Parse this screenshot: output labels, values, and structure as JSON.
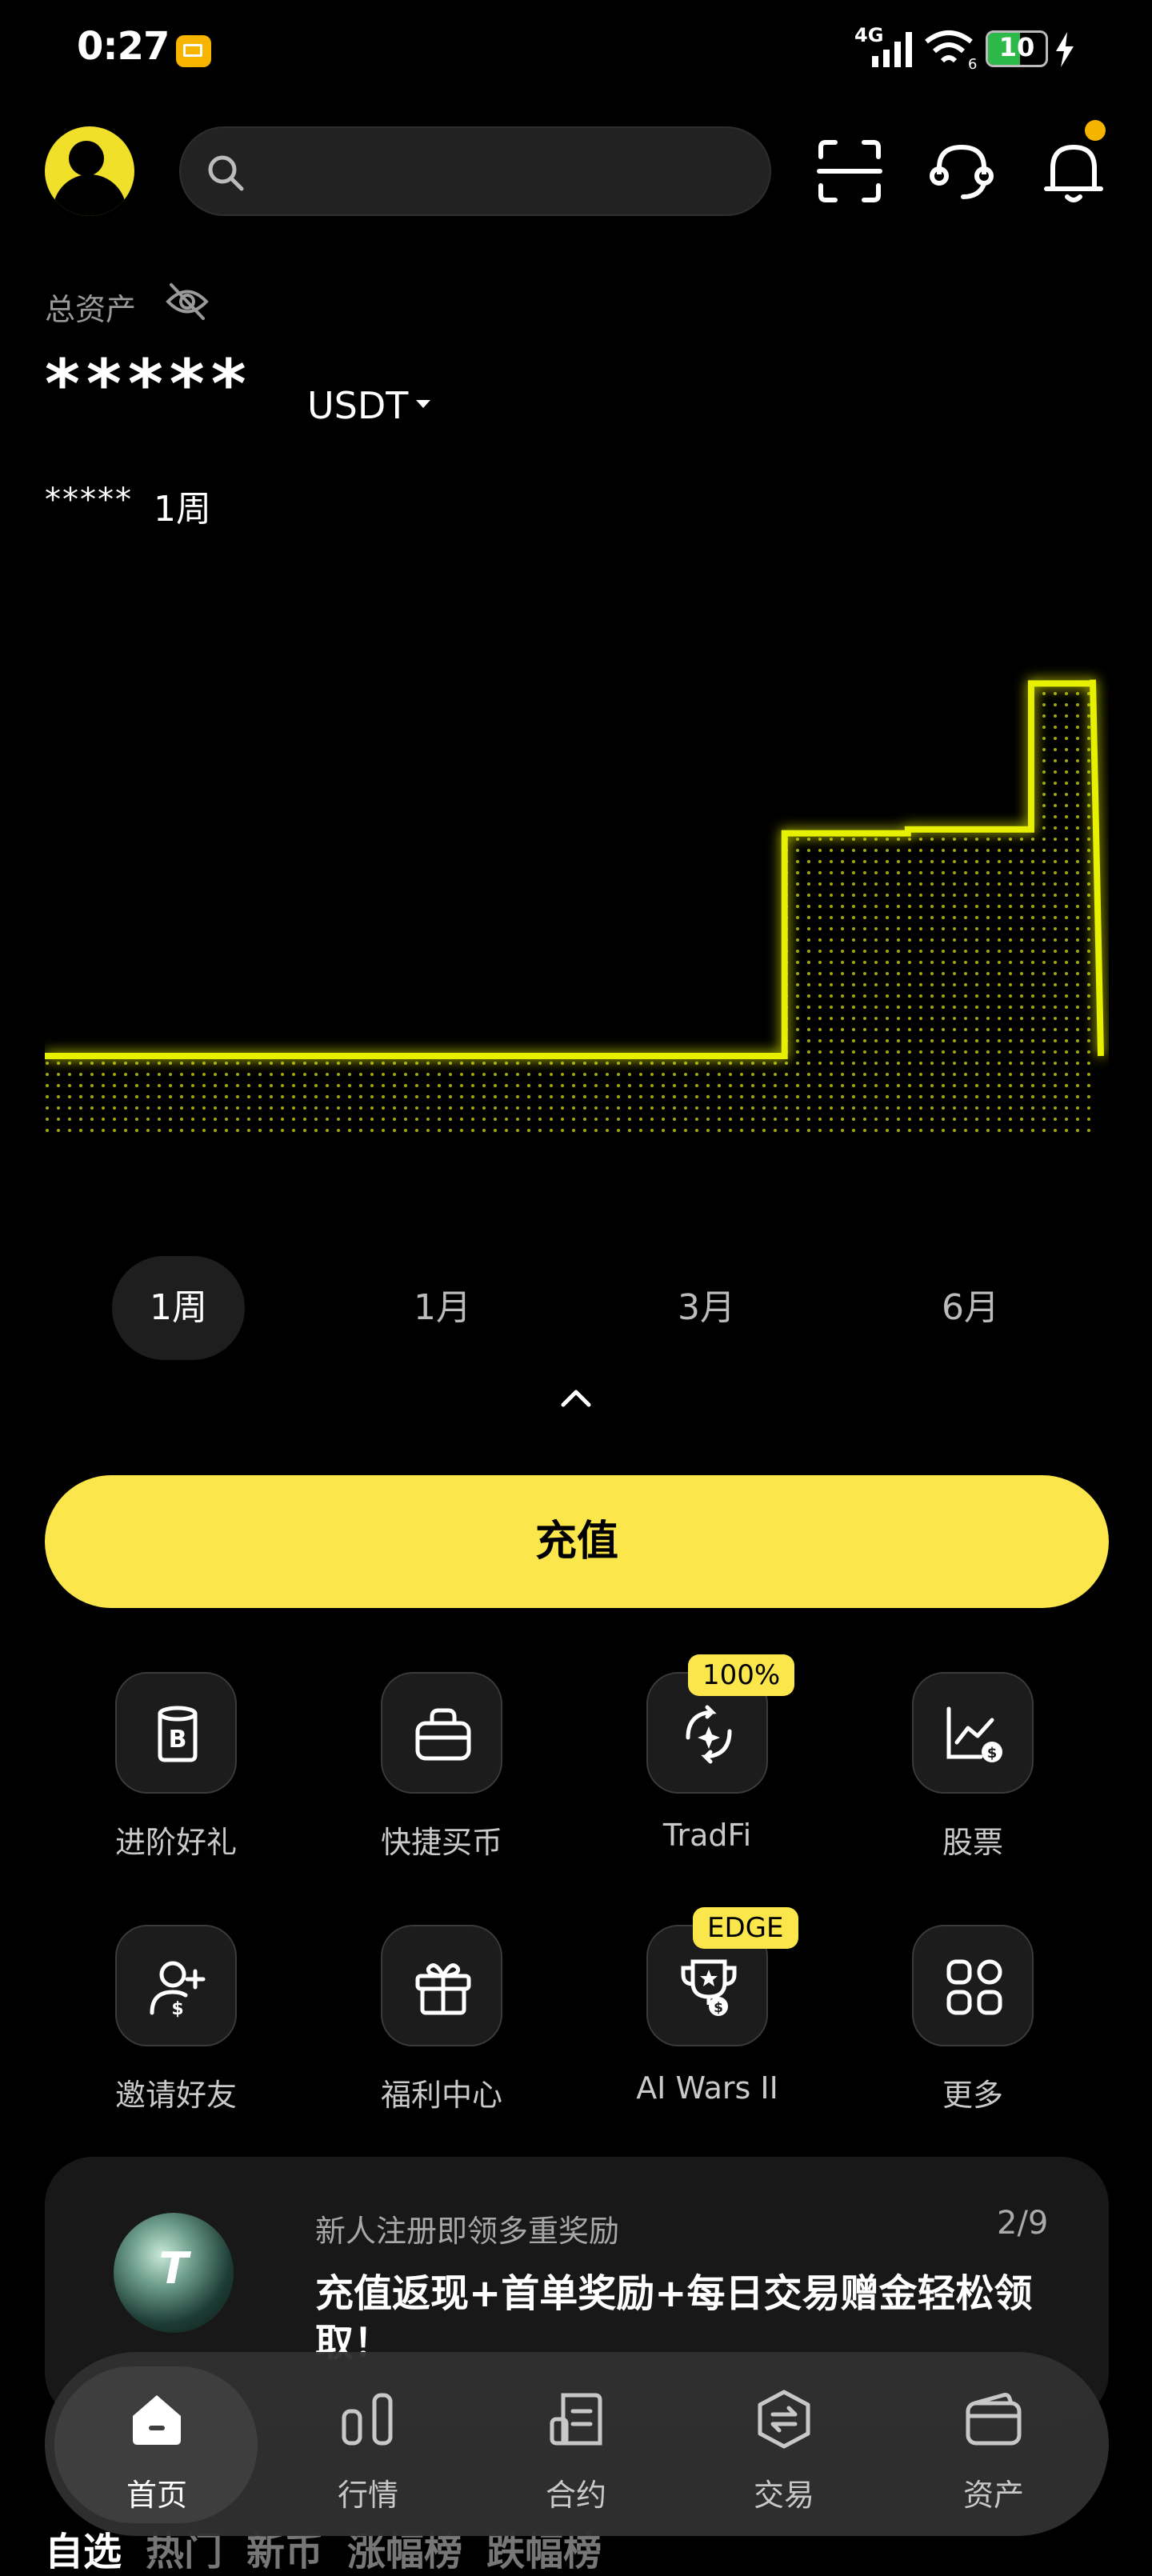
{
  "status_bar": {
    "time": "0:27",
    "network": "4G",
    "wifi_badge": "6",
    "battery": "10"
  },
  "header": {
    "search": {
      "placeholder": ""
    }
  },
  "assets": {
    "label": "总资产",
    "value_masked": "*****",
    "currency": "USDT",
    "pnl_masked": "*****",
    "pnl_period": "1周"
  },
  "chart_data": {
    "type": "area",
    "title": "",
    "x": [
      0,
      1,
      2,
      3,
      4,
      5,
      6,
      7,
      8,
      9,
      10,
      11,
      12,
      13,
      14,
      15,
      16,
      17
    ],
    "series": [
      {
        "values": [
          0,
          0,
          0,
          0,
          0,
          0,
          0,
          0,
          0,
          0,
          0,
          0,
          0.58,
          0.58,
          0.59,
          0.59,
          0.97,
          0.98
        ]
      }
    ],
    "ylim": [
      0,
      1
    ],
    "grid": false,
    "color": "#e6f000"
  },
  "periods": [
    "1周",
    "1月",
    "3月",
    "6月"
  ],
  "active_period": "1周",
  "deposit_label": "充值",
  "grid_items": [
    {
      "label": "进阶好礼",
      "icon": "bitcoin-jar-icon"
    },
    {
      "label": "快捷买币",
      "icon": "wallet-bag-icon"
    },
    {
      "label": "TradFi",
      "icon": "exchange-sparkle-icon",
      "badge": "100%"
    },
    {
      "label": "股票",
      "icon": "stock-chart-icon"
    },
    {
      "label": "邀请好友",
      "icon": "invite-user-icon"
    },
    {
      "label": "福利中心",
      "icon": "gift-icon"
    },
    {
      "label": "AI Wars II",
      "icon": "trophy-icon",
      "badge": "EDGE"
    },
    {
      "label": "更多",
      "icon": "more-grid-icon"
    }
  ],
  "promo": {
    "subtitle": "新人注册即领多重奖励",
    "page": "2/9",
    "title": "充值返现+首单奖励+每日交易赠金轻松领取！",
    "orb_letter": "T"
  },
  "market_tabs": [
    "自选",
    "热门",
    "新币",
    "涨幅榜",
    "跌幅榜"
  ],
  "bottom_nav": [
    {
      "label": "首页",
      "icon": "home-icon"
    },
    {
      "label": "行情",
      "icon": "market-icon"
    },
    {
      "label": "合约",
      "icon": "futures-icon"
    },
    {
      "label": "交易",
      "icon": "trade-icon"
    },
    {
      "label": "资产",
      "icon": "wallet-icon"
    }
  ],
  "colors": {
    "accent": "#fbe74c",
    "chart_line": "#e6f000",
    "background": "#000000",
    "badge_dot": "#f5b400"
  }
}
